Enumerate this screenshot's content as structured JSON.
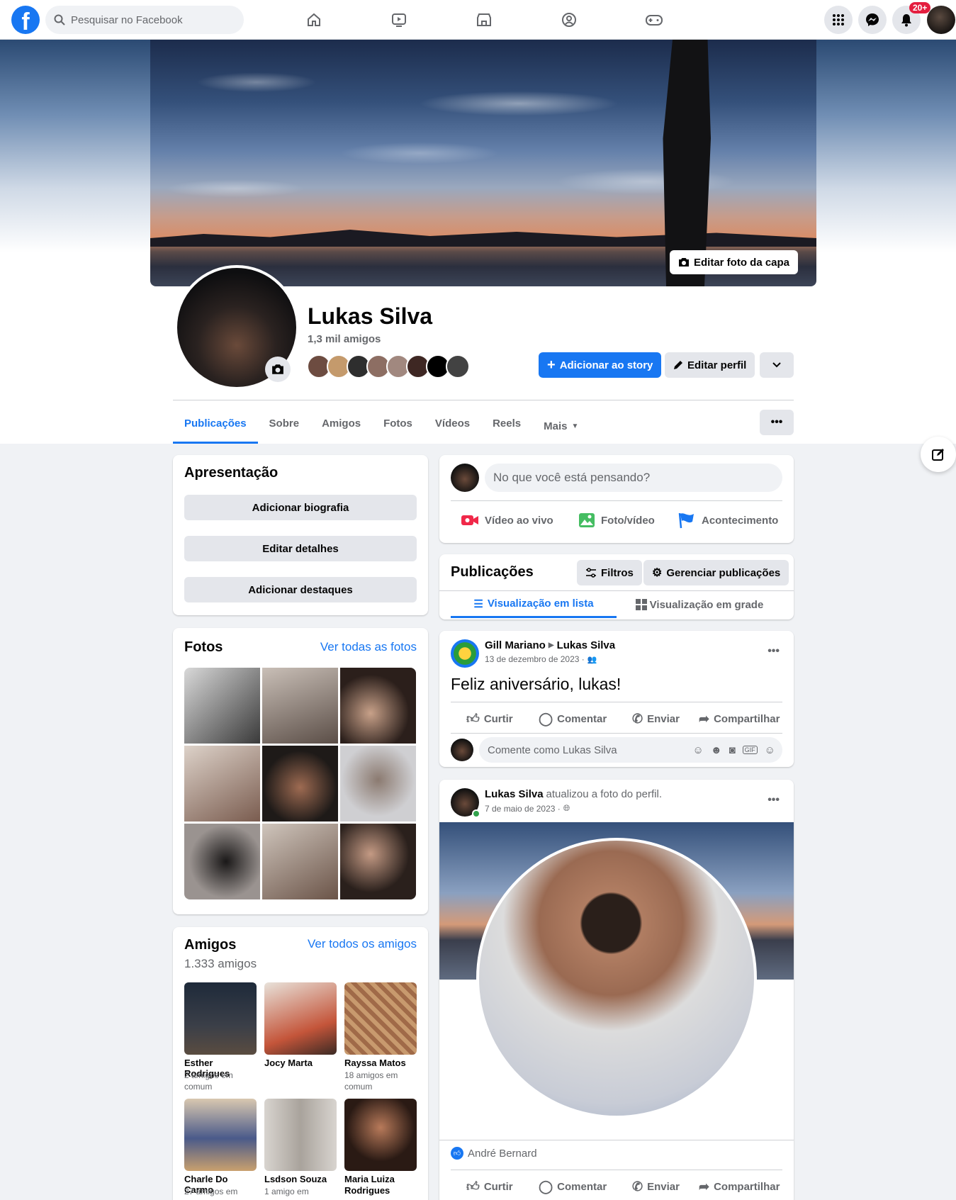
{
  "nav": {
    "logo": "f",
    "search_placeholder": "Pesquisar no Facebook",
    "notif_badge": "20+"
  },
  "profile": {
    "name": "Lukas Silva",
    "friends_count": "1,3 mil amigos",
    "edit_cover": "Editar foto da capa",
    "add_story": "Adicionar ao story",
    "edit_profile": "Editar perfil"
  },
  "tabs": [
    "Publicações",
    "Sobre",
    "Amigos",
    "Fotos",
    "Vídeos",
    "Reels",
    "Mais"
  ],
  "intro": {
    "title": "Apresentação",
    "buttons": [
      "Adicionar biografia",
      "Editar detalhes",
      "Adicionar destaques"
    ]
  },
  "photos": {
    "title": "Fotos",
    "see_all": "Ver todas as fotos"
  },
  "friends": {
    "title": "Amigos",
    "see_all": "Ver todos os amigos",
    "count": "1.333 amigos",
    "items": [
      {
        "name": "Esther Rodrigues",
        "mutual": "2 amigos em comum"
      },
      {
        "name": "Jocy Marta",
        "mutual": ""
      },
      {
        "name": "Rayssa Matos",
        "mutual": "18 amigos em comum"
      },
      {
        "name": "Charle Do Carmo",
        "mutual": "27 amigos em"
      },
      {
        "name": "Lsdson Souza",
        "mutual": "1 amigo em"
      },
      {
        "name": "Maria Luiza Rodrigues",
        "mutual": ""
      }
    ]
  },
  "composer": {
    "placeholder": "No que você está pensando?",
    "live": "Vídeo ao vivo",
    "photo": "Foto/vídeo",
    "event": "Acontecimento"
  },
  "posts_header": {
    "title": "Publicações",
    "filters": "Filtros",
    "manage": "Gerenciar publicações",
    "list_view": "Visualização em lista",
    "grid_view": "Visualização em grade"
  },
  "post1": {
    "author": "Gill Mariano",
    "target": "Lukas Silva",
    "date": "13 de dezembro de 2023 ·",
    "text": "Feliz aniversário, lukas!",
    "comment_placeholder": "Comente como Lukas Silva"
  },
  "post2": {
    "author": "Lukas Silva",
    "action": "atualizou a foto do perfil.",
    "date": "7 de maio de 2023 ·",
    "liker": "André Bernard"
  },
  "actions": {
    "like": "Curtir",
    "comment": "Comentar",
    "send": "Enviar",
    "share": "Compartilhar"
  },
  "colors": {
    "accent": "#1877f2",
    "badge": "#e41e3f",
    "background": "#f0f2f5"
  }
}
